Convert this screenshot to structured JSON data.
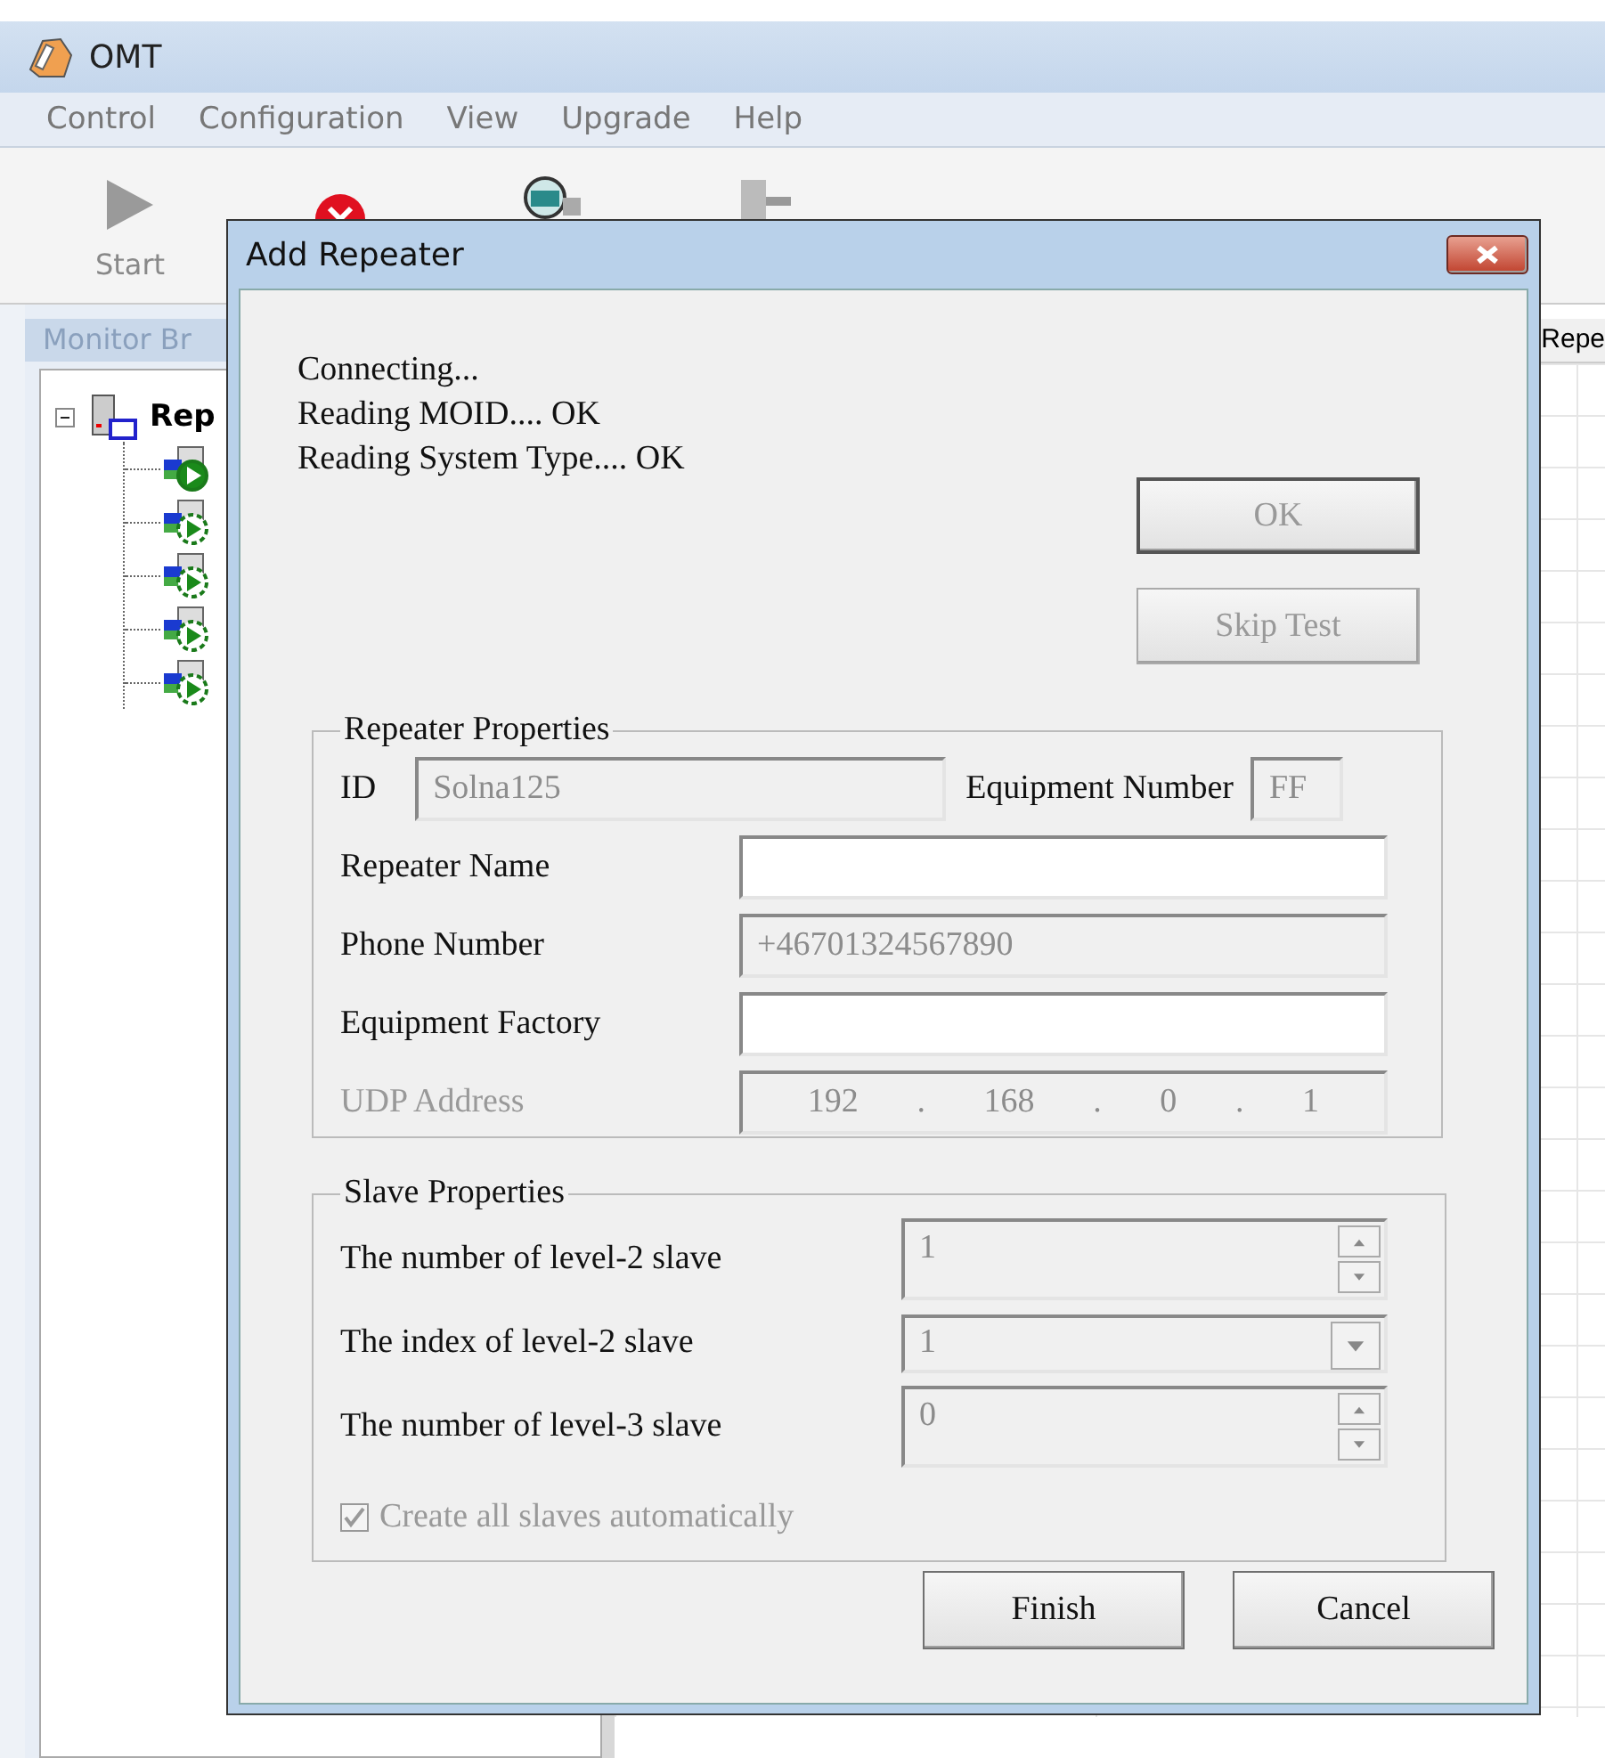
{
  "window": {
    "title": "OMT"
  },
  "menu": [
    "Control",
    "Configuration",
    "View",
    "Upgrade",
    "Help"
  ],
  "toolbar": [
    {
      "kind": "play",
      "label": "Start"
    },
    {
      "kind": "stop"
    },
    {
      "kind": "monitor"
    },
    {
      "kind": "plug"
    }
  ],
  "monitor_panel": {
    "title": "Monitor Br",
    "tree": [
      {
        "label": "Rep",
        "expanded": true,
        "children": [
          {
            "running": true
          },
          {
            "running": false
          },
          {
            "running": false
          },
          {
            "running": false
          },
          {
            "running": false
          }
        ]
      }
    ]
  },
  "right_panel": {
    "column_1": "Repe"
  },
  "dialog": {
    "title": "Add Repeater",
    "status_lines": [
      "Connecting...",
      "Reading MOID.... OK",
      "Reading System Type.... OK"
    ],
    "side_buttons": [
      {
        "label": "OK",
        "disabled": true,
        "default": true
      },
      {
        "label": "Skip Test",
        "disabled": true,
        "default": false
      }
    ],
    "repeater_properties": {
      "title": "Repeater Properties",
      "id": {
        "label": "ID",
        "value": "Solna125",
        "disabled": true
      },
      "equipment_number": {
        "label": "Equipment Number",
        "value": "FF",
        "disabled": true
      },
      "fields": [
        {
          "kind": "text",
          "label": "Repeater Name",
          "disabled": false
        },
        {
          "kind": "text",
          "label": "Phone Number",
          "value": "+46701324567890",
          "disabled": true
        },
        {
          "kind": "text",
          "label": "Equipment Factory",
          "disabled": false
        },
        {
          "kind": "ip",
          "label": "UDP Address",
          "octets": [
            "192",
            "168",
            "0",
            "1"
          ],
          "separator": ".",
          "disabled": true
        }
      ]
    },
    "slave_properties": {
      "title": "Slave Properties",
      "rows": [
        {
          "kind": "spinner",
          "label": "The number of level-2 slave",
          "value": "1",
          "disabled": true
        },
        {
          "kind": "combo",
          "label": "The index of level-2 slave",
          "value": "1",
          "disabled": true
        },
        {
          "kind": "spinner",
          "label": "The number of level-3 slave",
          "value": "0",
          "disabled": true
        }
      ],
      "auto_create": {
        "label": "Create all slaves automatically",
        "checked": true,
        "disabled": true
      }
    },
    "buttons": [
      {
        "label": "Finish"
      },
      {
        "label": "Cancel"
      }
    ]
  }
}
